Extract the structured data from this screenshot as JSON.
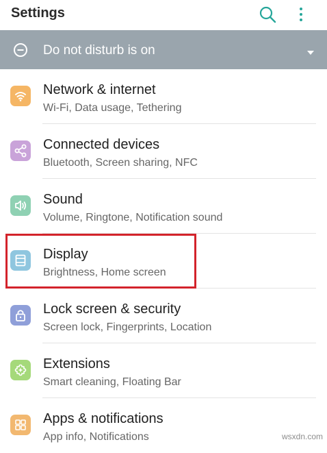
{
  "appbar": {
    "title": "Settings",
    "search_icon": "search-icon",
    "more_icon": "more-vert-icon",
    "accent": "#26a69a"
  },
  "dnd_banner": {
    "label": "Do not disturb is on",
    "icon": "do-not-disturb-icon",
    "background": "#9aa5ad"
  },
  "items": [
    {
      "title": "Network & internet",
      "subtitle": "Wi-Fi, Data usage, Tethering",
      "icon": "wifi-icon",
      "color": "#f5b665"
    },
    {
      "title": "Connected devices",
      "subtitle": "Bluetooth, Screen sharing, NFC",
      "icon": "share-icon",
      "color": "#c9a3d9"
    },
    {
      "title": "Sound",
      "subtitle": "Volume, Ringtone, Notification sound",
      "icon": "speaker-icon",
      "color": "#8fd1b3"
    },
    {
      "title": "Display",
      "subtitle": "Brightness, Home screen",
      "icon": "display-icon",
      "color": "#8fc6df"
    },
    {
      "title": "Lock screen & security",
      "subtitle": "Screen lock, Fingerprints, Location",
      "icon": "lock-icon",
      "color": "#8f9fd9"
    },
    {
      "title": "Extensions",
      "subtitle": "Smart cleaning, Floating Bar",
      "icon": "puzzle-icon",
      "color": "#a5d97a"
    },
    {
      "title": "Apps & notifications",
      "subtitle": "App info, Notifications",
      "icon": "apps-grid-icon",
      "color": "#f2b870"
    }
  ],
  "highlight_color": "#d3232b",
  "watermark": "wsxdn.com"
}
